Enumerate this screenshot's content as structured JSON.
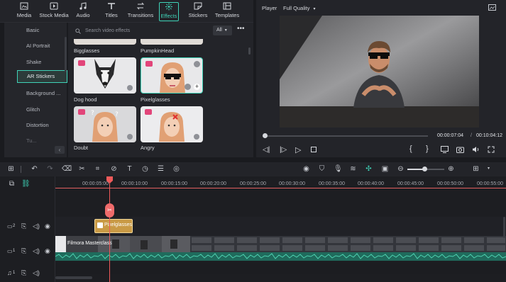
{
  "top_tabs": [
    {
      "label": "Media",
      "icon": "media-icon"
    },
    {
      "label": "Stock Media",
      "icon": "stock-media-icon"
    },
    {
      "label": "Audio",
      "icon": "audio-icon"
    },
    {
      "label": "Titles",
      "icon": "titles-icon"
    },
    {
      "label": "Transitions",
      "icon": "transitions-icon"
    },
    {
      "label": "Effects",
      "icon": "effects-icon",
      "active": true
    },
    {
      "label": "Stickers",
      "icon": "stickers-icon"
    },
    {
      "label": "Templates",
      "icon": "templates-icon"
    }
  ],
  "sidebar": {
    "items": [
      "Basic",
      "AI Portrait",
      "Shake",
      "AR Stickers",
      "Background ...",
      "Glitch",
      "Distortion",
      "Tu..."
    ],
    "active": "AR Stickers"
  },
  "effects": {
    "search_placeholder": "Search video effects",
    "filter": "All",
    "top_labels": [
      "Bigglasses",
      "PumpkinHead"
    ],
    "cards": [
      {
        "label": "Dog hood"
      },
      {
        "label": "Pixelglasses"
      },
      {
        "label": "Doubt"
      },
      {
        "label": "Angry"
      }
    ]
  },
  "player": {
    "label": "Player",
    "quality": "Full Quality",
    "current_time": "00:00:07:04",
    "total_time": "00:10:04:12",
    "time_separator": "/",
    "progress": 0.01
  },
  "timeline": {
    "ruler": [
      "00:00:05:00",
      "00:00:10:00",
      "00:00:15:00",
      "00:00:20:00",
      "00:00:25:00",
      "00:00:30:00",
      "00:00:35:00",
      "00:00:40:00",
      "00:00:45:00",
      "00:00:50:00",
      "00:00:55:00"
    ],
    "effect_clip": "Pixelglasses",
    "video_clip": "Filmora Masterclass",
    "tracks": [
      {
        "num": "2"
      },
      {
        "num": "1"
      },
      {
        "num": "1"
      }
    ]
  },
  "colors": {
    "accent": "#3fd3b8",
    "playhead": "#ef5a5a",
    "effect_clip": "#c99a45",
    "audio": "#2a8f7a"
  }
}
